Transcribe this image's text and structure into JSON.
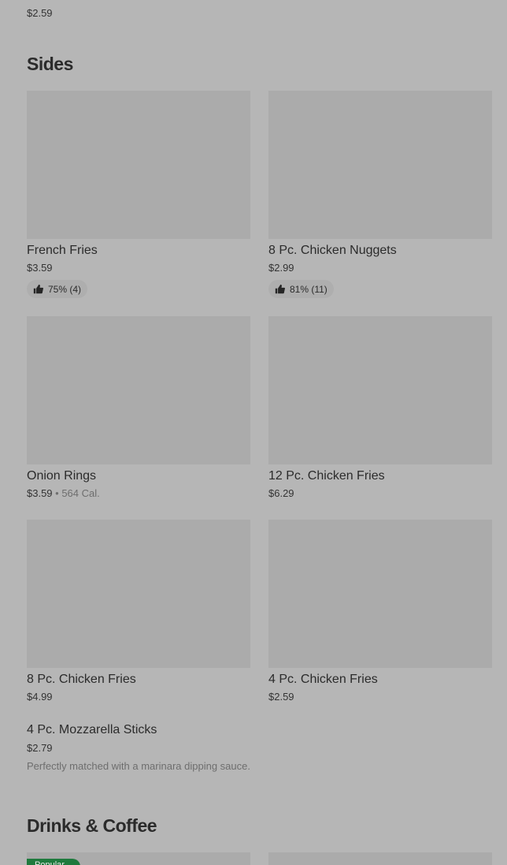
{
  "top_item": {
    "price": "$2.59"
  },
  "sections": {
    "sides": {
      "title": "Sides",
      "items": [
        {
          "name": "French Fries",
          "price": "$3.59",
          "rating": "75% (4)",
          "rating_icon": "thumbs-up-icon"
        },
        {
          "name": "8 Pc. Chicken Nuggets",
          "price": "$2.99",
          "rating": "81% (11)",
          "rating_icon": "thumbs-up-icon"
        },
        {
          "name": "Onion Rings",
          "price": "$3.59",
          "calories": " • 564 Cal."
        },
        {
          "name": "12 Pc. Chicken Fries",
          "price": "$6.29"
        },
        {
          "name": "8 Pc. Chicken Fries",
          "price": "$4.99"
        },
        {
          "name": "4 Pc. Chicken Fries",
          "price": "$2.59"
        }
      ],
      "text_item": {
        "name": "4 Pc. Mozzarella Sticks",
        "price": "$2.79",
        "description": "Perfectly matched with a marinara dipping sauce."
      }
    },
    "drinks": {
      "title": "Drinks & Coffee",
      "badge": "Popular"
    }
  },
  "colors": {
    "background": "#b6b6b6",
    "image_placeholder": "#ababab",
    "badge_green": "#1f7a3e"
  }
}
